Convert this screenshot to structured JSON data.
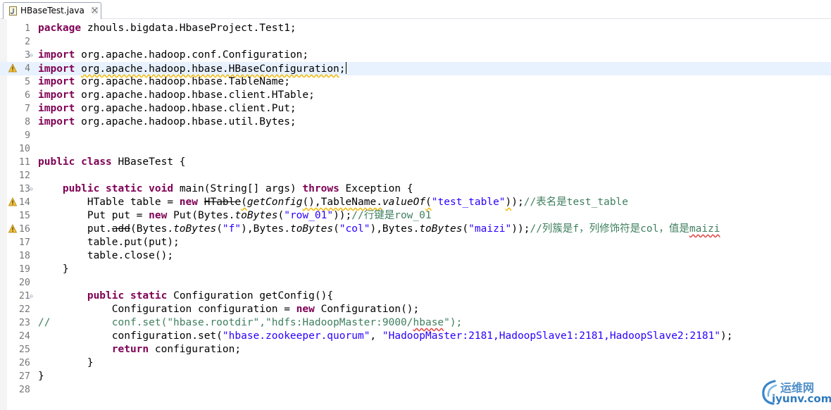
{
  "tab": {
    "label": "HBaseTest.java",
    "icon": "java-file-icon",
    "close_icon": "close-tab-icon"
  },
  "editor": {
    "current_line": 4,
    "colors": {
      "keyword": "#7f0055",
      "string": "#2a00ff",
      "comment": "#3f7f5f",
      "field": "#0000c0",
      "current_line_bg": "#e8f2fe"
    },
    "lines": [
      {
        "n": "1",
        "parts": [
          [
            "kw",
            "package"
          ],
          [
            "p",
            " zhouls.bigdata.HbaseProject.Test1;"
          ]
        ]
      },
      {
        "n": "2",
        "parts": []
      },
      {
        "n": "3",
        "fold": "collapse",
        "parts": [
          [
            "kw",
            "import"
          ],
          [
            "p",
            " org.apache.hadoop.conf.Configuration;"
          ]
        ]
      },
      {
        "n": "4",
        "marker": "warning-icon",
        "current": true,
        "parts": [
          [
            "kw",
            "import"
          ],
          [
            "p",
            " "
          ],
          [
            "warn",
            "org.apache.hadoop.hbase.HBaseConfiguration"
          ],
          [
            "p",
            ";"
          ],
          [
            "caret",
            ""
          ]
        ]
      },
      {
        "n": "5",
        "parts": [
          [
            "kw",
            "import"
          ],
          [
            "p",
            " org.apache.hadoop.hbase.TableName;"
          ]
        ]
      },
      {
        "n": "6",
        "parts": [
          [
            "kw",
            "import"
          ],
          [
            "p",
            " org.apache.hadoop.hbase.client.HTable;"
          ]
        ]
      },
      {
        "n": "7",
        "parts": [
          [
            "kw",
            "import"
          ],
          [
            "p",
            " org.apache.hadoop.hbase.client.Put;"
          ]
        ]
      },
      {
        "n": "8",
        "parts": [
          [
            "kw",
            "import"
          ],
          [
            "p",
            " org.apache.hadoop.hbase.util.Bytes;"
          ]
        ]
      },
      {
        "n": "9",
        "parts": []
      },
      {
        "n": "10",
        "parts": []
      },
      {
        "n": "11",
        "parts": [
          [
            "kw",
            "public"
          ],
          [
            "p",
            " "
          ],
          [
            "kw",
            "class"
          ],
          [
            "p",
            " HBaseTest {"
          ]
        ]
      },
      {
        "n": "12",
        "parts": []
      },
      {
        "n": "13",
        "fold": "collapse",
        "parts": [
          [
            "p",
            "    "
          ],
          [
            "kw",
            "public"
          ],
          [
            "p",
            " "
          ],
          [
            "kw",
            "static"
          ],
          [
            "p",
            " "
          ],
          [
            "kw",
            "void"
          ],
          [
            "p",
            " main(String[] args) "
          ],
          [
            "kw",
            "throws"
          ],
          [
            "p",
            " Exception {"
          ]
        ]
      },
      {
        "n": "14",
        "marker": "warning-icon",
        "parts": [
          [
            "p",
            "        HTable table = "
          ],
          [
            "kw",
            "new"
          ],
          [
            "p",
            " "
          ],
          [
            "del",
            "HTable"
          ],
          [
            "warn",
            "("
          ],
          [
            "it",
            "getConfig"
          ],
          [
            "warn",
            "(),TableName."
          ],
          [
            "it",
            "valueOf"
          ],
          [
            "warn",
            "("
          ],
          [
            "str",
            "\"test_table\""
          ],
          [
            "warn",
            ")"
          ],
          [
            "p",
            ");"
          ],
          [
            "cmt",
            "//表名是test_table"
          ]
        ]
      },
      {
        "n": "15",
        "parts": [
          [
            "p",
            "        Put put = "
          ],
          [
            "kw",
            "new"
          ],
          [
            "p",
            " Put(Bytes."
          ],
          [
            "it",
            "toBytes"
          ],
          [
            "p",
            "("
          ],
          [
            "str",
            "\"row_01\""
          ],
          [
            "p",
            "));"
          ],
          [
            "cmt",
            "//行键是row_01"
          ]
        ]
      },
      {
        "n": "16",
        "marker": "warning-icon",
        "parts": [
          [
            "p",
            "        put."
          ],
          [
            "del",
            "add"
          ],
          [
            "p",
            "(Bytes."
          ],
          [
            "it",
            "toBytes"
          ],
          [
            "p",
            "("
          ],
          [
            "str",
            "\"f\""
          ],
          [
            "p",
            "),Bytes."
          ],
          [
            "it",
            "toBytes"
          ],
          [
            "p",
            "("
          ],
          [
            "str",
            "\"col\""
          ],
          [
            "p",
            "),Bytes."
          ],
          [
            "it",
            "toBytes"
          ],
          [
            "p",
            "("
          ],
          [
            "str",
            "\"maizi\""
          ],
          [
            "p",
            "));"
          ],
          [
            "cmt",
            "//列簇是f，列修饰符是col，值是"
          ],
          [
            "cmtspell",
            "maizi"
          ]
        ]
      },
      {
        "n": "17",
        "parts": [
          [
            "p",
            "        table.put(put);"
          ]
        ]
      },
      {
        "n": "18",
        "parts": [
          [
            "p",
            "        table.close();"
          ]
        ]
      },
      {
        "n": "19",
        "parts": [
          [
            "p",
            "    }"
          ]
        ]
      },
      {
        "n": "20",
        "parts": []
      },
      {
        "n": "21",
        "fold": "collapse",
        "parts": [
          [
            "p",
            "        "
          ],
          [
            "kw",
            "public"
          ],
          [
            "p",
            " "
          ],
          [
            "kw",
            "static"
          ],
          [
            "p",
            " Configuration getConfig(){"
          ]
        ]
      },
      {
        "n": "22",
        "parts": [
          [
            "p",
            "            Configuration configuration = "
          ],
          [
            "kw",
            "new"
          ],
          [
            "p",
            " Configuration();"
          ]
        ]
      },
      {
        "n": "23",
        "parts": [
          [
            "cmt",
            "//          conf.set(\"hbase.rootdir\",\"hdfs:HadoopMaster:9000/"
          ],
          [
            "cmtspell",
            "hbase"
          ],
          [
            "cmt",
            "\");"
          ]
        ]
      },
      {
        "n": "24",
        "parts": [
          [
            "p",
            "            configuration.set("
          ],
          [
            "str",
            "\"hbase.zookeeper.quorum\""
          ],
          [
            "p",
            ", "
          ],
          [
            "str",
            "\"HadoopMaster:2181,HadoopSlave1:2181,HadoopSlave2:2181\""
          ],
          [
            "p",
            ");"
          ]
        ]
      },
      {
        "n": "25",
        "parts": [
          [
            "p",
            "            "
          ],
          [
            "kw",
            "return"
          ],
          [
            "p",
            " configuration;"
          ]
        ]
      },
      {
        "n": "26",
        "parts": [
          [
            "p",
            "        }"
          ]
        ]
      },
      {
        "n": "27",
        "parts": [
          [
            "p",
            "}"
          ]
        ]
      },
      {
        "n": "28",
        "parts": []
      }
    ]
  },
  "watermark": {
    "chinese": "运维网",
    "domain": "iyunv.com",
    "icon": "iyunv-logo-icon"
  }
}
